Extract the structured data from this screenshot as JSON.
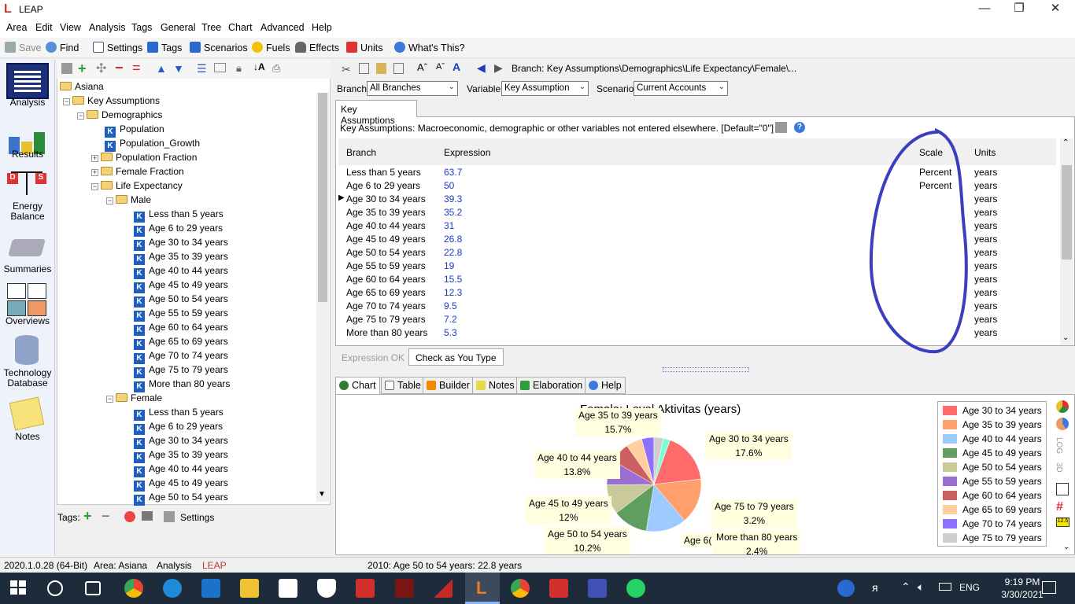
{
  "window": {
    "title": "LEAP",
    "minimize": "—",
    "restore": "❐",
    "close": "✕"
  },
  "menu": [
    "Area",
    "Edit",
    "View",
    "Analysis",
    "Tags",
    "General",
    "Tree",
    "Chart",
    "Advanced",
    "Help"
  ],
  "toolbar": {
    "save": "Save",
    "find": "Find",
    "settings": "Settings",
    "tags": "Tags",
    "scenarios": "Scenarios",
    "fuels": "Fuels",
    "effects": "Effects",
    "units": "Units",
    "whats_this": "What's This?"
  },
  "nav": [
    "Analysis",
    "Results",
    "Energy Balance",
    "Summaries",
    "Overviews",
    "Technology Database",
    "Notes"
  ],
  "tree": {
    "root": "Asiana",
    "key_assumptions": "Key Assumptions",
    "demographics": "Demographics",
    "population": "Population",
    "population_growth": "Population_Growth",
    "population_fraction": "Population Fraction",
    "female_fraction": "Female Fraction",
    "life_expectancy": "Life Expectancy",
    "male": "Male",
    "male_items": [
      "Less than 5 years",
      "Age 6 to 29 years",
      "Age 30 to 34 years",
      "Age 35 to 39 years",
      "Age 40 to 44 years",
      "Age 45 to 49 years",
      "Age 50 to 54 years",
      "Age 55 to 59 years",
      "Age 60 to 64 years",
      "Age 65 to 69 years",
      "Age 70 to 74 years",
      "Age 75 to 79 years",
      "More than 80 years"
    ],
    "female": "Female",
    "female_items": [
      "Less than 5 years",
      "Age 6 to 29 years",
      "Age 30 to 34 years",
      "Age 35 to 39 years",
      "Age 40 to 44 years",
      "Age 45 to 49 years",
      "Age 50 to 54 years"
    ]
  },
  "tags_bar": {
    "label": "Tags:",
    "settings": "Settings"
  },
  "right": {
    "breadcrumb": "Branch: Key Assumptions\\Demographics\\Life Expectancy\\Female\\...",
    "branch_label": "Branch:",
    "branch_value": "All Branches",
    "variable_label": "Variable:",
    "variable_value": "Key Assumption",
    "scenario_label": "Scenario:",
    "scenario_value": "Current Accounts",
    "tab": "Key Assumptions",
    "description": "Key Assumptions: Macroeconomic, demographic or other variables not entered elsewhere. [Default=\"0\"]"
  },
  "grid": {
    "headers": {
      "branch": "Branch",
      "expression": "Expression",
      "scale": "Scale",
      "units": "Units"
    },
    "rows": [
      {
        "branch": "Less than 5 years",
        "expression": "63.7",
        "scale": "Percent",
        "units": "years"
      },
      {
        "branch": "Age 6 to 29 years",
        "expression": "50",
        "scale": "Percent",
        "units": "years"
      },
      {
        "branch": "Age 30 to 34 years",
        "expression": "39.3",
        "scale": "",
        "units": "years"
      },
      {
        "branch": "Age 35 to 39 years",
        "expression": "35.2",
        "scale": "",
        "units": "years"
      },
      {
        "branch": "Age 40 to 44 years",
        "expression": "31",
        "scale": "",
        "units": "years"
      },
      {
        "branch": "Age 45 to 49 years",
        "expression": "26.8",
        "scale": "",
        "units": "years"
      },
      {
        "branch": "Age 50 to 54 years",
        "expression": "22.8",
        "scale": "",
        "units": "years"
      },
      {
        "branch": "Age 55 to 59 years",
        "expression": "19",
        "scale": "",
        "units": "years"
      },
      {
        "branch": "Age 60 to 64 years",
        "expression": "15.5",
        "scale": "",
        "units": "years"
      },
      {
        "branch": "Age 65 to 69 years",
        "expression": "12.3",
        "scale": "",
        "units": "years"
      },
      {
        "branch": "Age 70 to 74 years",
        "expression": "9.5",
        "scale": "",
        "units": "years"
      },
      {
        "branch": "Age 75 to 79 years",
        "expression": "7.2",
        "scale": "",
        "units": "years"
      },
      {
        "branch": "More than 80 years",
        "expression": "5.3",
        "scale": "",
        "units": "years"
      }
    ],
    "current_row": 2
  },
  "expression_bar": {
    "status": "Expression OK",
    "check": "Check as You Type"
  },
  "bottom_tabs": [
    "Chart",
    "Table",
    "Builder",
    "Notes",
    "Elaboration",
    "Help"
  ],
  "side_tools": {
    "log": "LOG",
    "three_d": "3D"
  },
  "chart_data": {
    "type": "pie",
    "title": "Female: Level Aktivitas (years)",
    "slices": [
      {
        "label": "Age 30 to 34 years",
        "pct_label": "17.6%",
        "value": 17.6,
        "color": "#ff6b6b"
      },
      {
        "label": "Age 35 to 39 years",
        "pct_label": "15.7%",
        "value": 15.7,
        "color": "#ff9f6b"
      },
      {
        "label": "Age 40 to 44 years",
        "pct_label": "13.8%",
        "value": 13.8,
        "color": "#9ecbff"
      },
      {
        "label": "Age 45 to 49 years",
        "pct_label": "12%",
        "value": 12,
        "color": "#5f9e5f"
      },
      {
        "label": "Age 50 to 54 years",
        "pct_label": "10.2%",
        "value": 10.2,
        "color": "#c9c99a"
      },
      {
        "label": "Age 55 to 59 years",
        "pct_label": "",
        "value": 8.5,
        "color": "#9b6fd1"
      },
      {
        "label": "Age 60 to 64 years",
        "pct_label": "",
        "value": 6.9,
        "color": "#cc5f5f"
      },
      {
        "label": "Age 65 to 69 years",
        "pct_label": "",
        "value": 5.5,
        "color": "#ffcfa0"
      },
      {
        "label": "Age 70 to 74 years",
        "pct_label": "",
        "value": 4.2,
        "color": "#8f6fff"
      },
      {
        "label": "Age 75 to 79 years",
        "pct_label": "3.2%",
        "value": 3.2,
        "color": "#cfcfcf"
      },
      {
        "label": "More than 80 years",
        "pct_label": "2.4%",
        "value": 2.4,
        "color": "#7fffd4"
      }
    ],
    "partial_label": "Age 6(",
    "legend": [
      "Age 30 to 34 years",
      "Age 35 to 39 years",
      "Age 40 to 44 years",
      "Age 45 to 49 years",
      "Age 50 to 54 years",
      "Age 55 to 59 years",
      "Age 60 to 64 years",
      "Age 65 to 69 years",
      "Age 70 to 74 years",
      "Age 75 to 79 years"
    ],
    "legend_colors": [
      "#ff6b6b",
      "#ff9f6b",
      "#9ecbff",
      "#5f9e5f",
      "#c9c99a",
      "#9b6fd1",
      "#cc5f5f",
      "#ffcfa0",
      "#8f6fff",
      "#cfcfcf"
    ]
  },
  "status": {
    "version": "2020.1.0.28 (64-Bit)",
    "area": "Area: Asiana",
    "view": "Analysis",
    "app": "LEAP",
    "info": "2010: Age 50 to 54 years: 22.8 years"
  },
  "taskbar": {
    "language": "ENG",
    "time": "9:19 PM",
    "date": "3/30/2021"
  }
}
